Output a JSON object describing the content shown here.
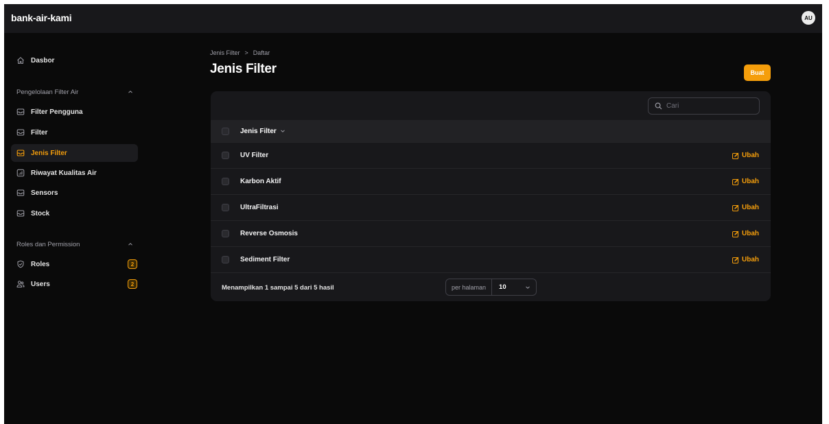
{
  "app": {
    "title": "bank-air-kami",
    "user_initials": "AU"
  },
  "sidebar": {
    "dashboard": {
      "label": "Dasbor",
      "icon": "home-icon"
    },
    "groups": [
      {
        "label": "Pengelolaan Filter Air",
        "items": [
          {
            "label": "Filter Pengguna",
            "icon": "inbox-icon"
          },
          {
            "label": "Filter",
            "icon": "inbox-icon"
          },
          {
            "label": "Jenis Filter",
            "icon": "inbox-icon",
            "active": true
          },
          {
            "label": "Riwayat Kualitas Air",
            "icon": "chart-icon"
          },
          {
            "label": "Sensors",
            "icon": "inbox-icon"
          },
          {
            "label": "Stock",
            "icon": "inbox-icon"
          }
        ]
      },
      {
        "label": "Roles dan Permission",
        "items": [
          {
            "label": "Roles",
            "icon": "shield-check-icon",
            "badge": "2"
          },
          {
            "label": "Users",
            "icon": "users-icon",
            "badge": "2"
          }
        ]
      }
    ]
  },
  "breadcrumb": {
    "items": [
      "Jenis Filter",
      "Daftar"
    ],
    "separator": ">"
  },
  "page": {
    "title": "Jenis Filter",
    "create_label": "Buat"
  },
  "table": {
    "search_placeholder": "Cari",
    "column_header": "Jenis Filter",
    "rows": [
      {
        "name": "UV Filter",
        "action": "Ubah"
      },
      {
        "name": "Karbon Aktif",
        "action": "Ubah"
      },
      {
        "name": "UltraFiltrasi",
        "action": "Ubah"
      },
      {
        "name": "Reverse Osmosis",
        "action": "Ubah"
      },
      {
        "name": "Sediment Filter",
        "action": "Ubah"
      }
    ],
    "summary": "Menampilkan 1 sampai 5 dari 5 hasil",
    "per_page_label": "per halaman",
    "per_page_value": "10"
  },
  "colors": {
    "accent": "#f59e0b",
    "background": "#0a0a0a",
    "surface": "#18181b"
  }
}
